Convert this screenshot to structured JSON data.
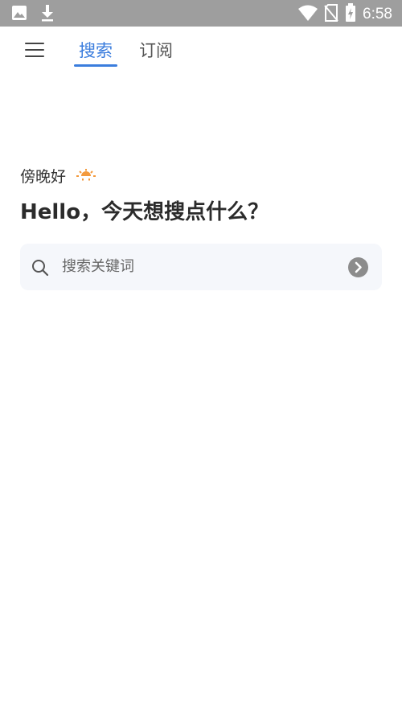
{
  "status_bar": {
    "time": "6:58",
    "left_icons": [
      "image-icon",
      "download-icon"
    ],
    "right_icons": [
      "wifi-icon",
      "no-sim-icon",
      "battery-charging-icon"
    ],
    "background": "#9e9e9e"
  },
  "nav": {
    "tabs": [
      {
        "label": "搜索",
        "active": true
      },
      {
        "label": "订阅",
        "active": false
      }
    ],
    "accent_color": "#3b7ddd"
  },
  "greeting": {
    "text": "傍晚好",
    "icon": "sunset-icon"
  },
  "headline": "Hello，今天想搜点什么？",
  "search": {
    "placeholder": "搜索关键词"
  }
}
